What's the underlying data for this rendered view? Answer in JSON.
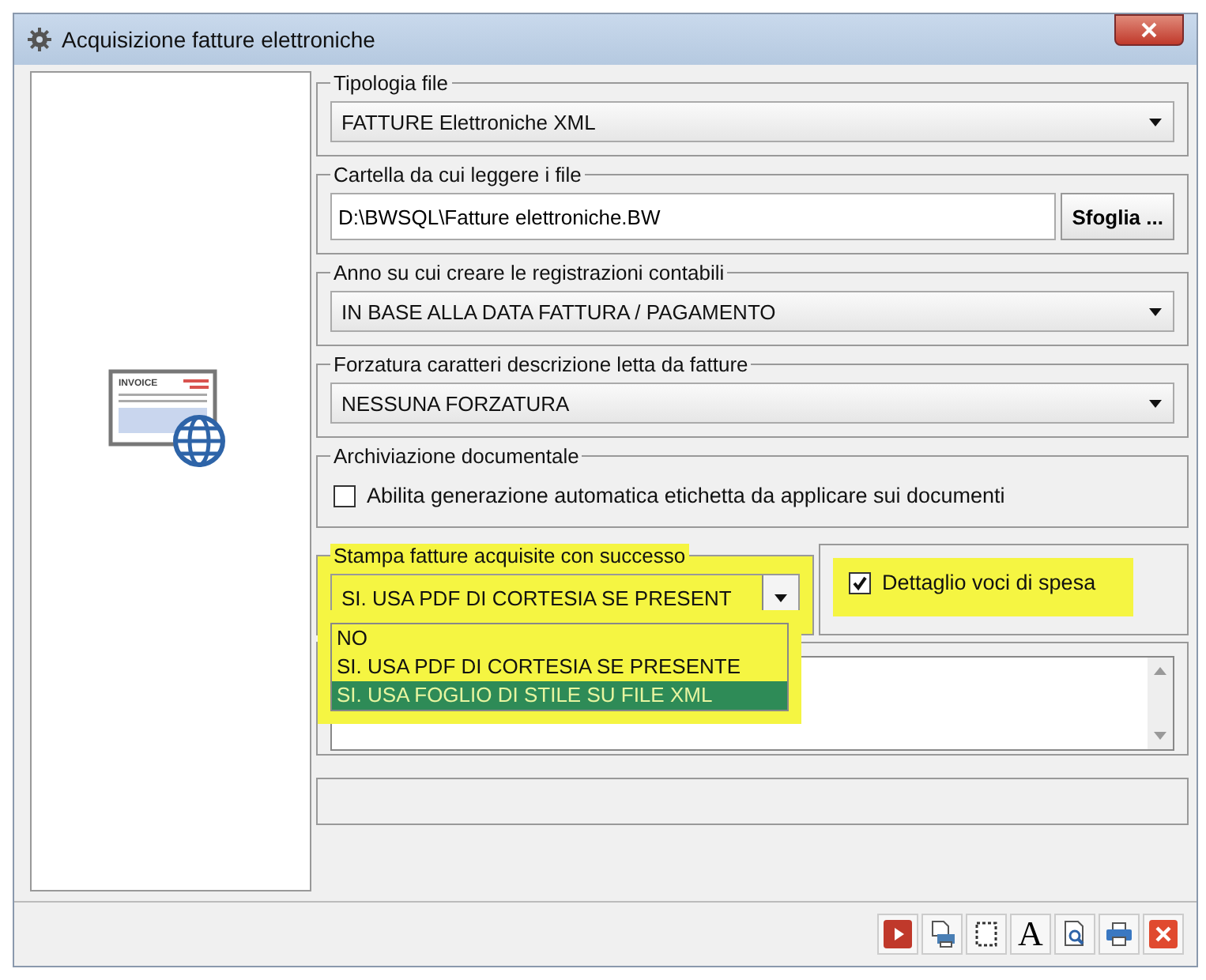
{
  "window": {
    "title": "Acquisizione fatture elettroniche"
  },
  "icon_label": "INVOICE",
  "groups": [
    {
      "kind": "combo",
      "legend": "Tipologia file",
      "value": "FATTURE Elettroniche XML"
    },
    {
      "kind": "folder",
      "legend": "Cartella da cui leggere i file",
      "value": "D:\\BWSQL\\Fatture elettroniche.BW",
      "button": "Sfoglia ..."
    },
    {
      "kind": "combo",
      "legend": "Anno su cui creare le registrazioni contabili",
      "value": "IN BASE ALLA DATA FATTURA / PAGAMENTO"
    },
    {
      "kind": "combo",
      "legend": "Forzatura caratteri descrizione letta da fatture",
      "value": "NESSUNA FORZATURA"
    },
    {
      "kind": "checkbox",
      "legend": "Archiviazione documentale",
      "label": "Abilita generazione automatica etichetta da applicare sui documenti",
      "checked": false
    }
  ],
  "print": {
    "legend": "Stampa fatture acquisite con successo",
    "value": "SI. USA PDF DI CORTESIA SE PRESENT",
    "highlighted": true,
    "expanded": true,
    "options": [
      {
        "label": "NO",
        "selected": false
      },
      {
        "label": "SI. USA PDF DI CORTESIA SE PRESENTE",
        "selected": false
      },
      {
        "label": "SI. USA FOGLIO DI STILE SU FILE XML",
        "selected": true
      }
    ],
    "detail": {
      "label": "Dettaglio voci di spesa",
      "checked": true,
      "highlighted": true
    }
  },
  "toolbar": [
    {
      "kind": "video"
    },
    {
      "kind": "print-setup"
    },
    {
      "kind": "margins"
    },
    {
      "kind": "font",
      "label": "A"
    },
    {
      "kind": "preview"
    },
    {
      "kind": "print"
    },
    {
      "kind": "close"
    }
  ]
}
